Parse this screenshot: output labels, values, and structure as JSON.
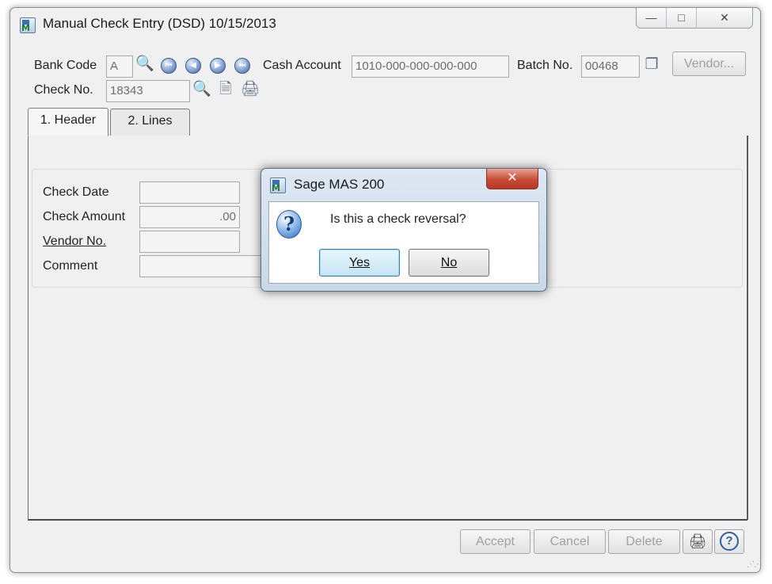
{
  "window": {
    "title": "Manual Check Entry (DSD) 10/15/2013",
    "caption_buttons": [
      "—",
      "□",
      "✕"
    ]
  },
  "toolbar": {
    "bank_code_label": "Bank Code",
    "bank_code_value": "A",
    "cash_account_label": "Cash Account",
    "cash_account_value": "1010-000-000-000-000",
    "batch_no_label": "Batch No.",
    "batch_no_value": "00468",
    "vendor_button": "Vendor...",
    "check_no_label": "Check No.",
    "check_no_value": "18343",
    "icons": [
      "search-icon",
      "first-record-icon",
      "previous-record-icon",
      "next-record-icon",
      "last-record-icon",
      "batch-icon",
      "next-number-icon",
      "print-icon"
    ]
  },
  "tabs": [
    {
      "label": "1. Header",
      "selected": true
    },
    {
      "label": "2. Lines",
      "selected": false
    }
  ],
  "header_form": {
    "check_date_label": "Check Date",
    "check_date_value": "",
    "check_amount_label": "Check Amount",
    "check_amount_value": ".00",
    "vendor_no_label": "Vendor No.",
    "vendor_no_value": "",
    "comment_label": "Comment",
    "comment_value": ""
  },
  "footer": {
    "accept": "Accept",
    "cancel": "Cancel",
    "delete": "Delete"
  },
  "dialog": {
    "title": "Sage MAS 200",
    "message": "Is this a check reversal?",
    "yes": "Yes",
    "no": "No",
    "icon": "question-icon"
  }
}
